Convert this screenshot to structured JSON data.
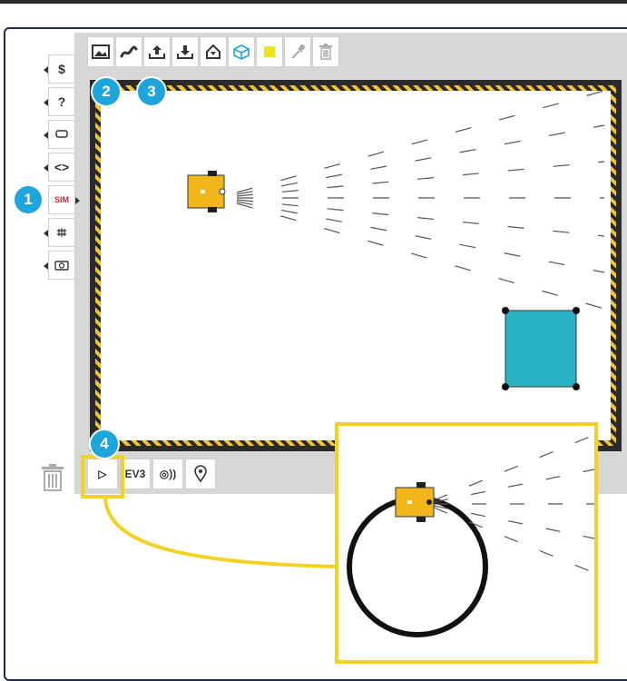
{
  "toolbar": {
    "tools": [
      {
        "icon": "image-icon",
        "name": "background-image-tool"
      },
      {
        "icon": "line-pen-icon",
        "name": "draw-line-tool"
      },
      {
        "icon": "upload-icon",
        "name": "import-tool"
      },
      {
        "icon": "download-icon",
        "name": "export-tool"
      },
      {
        "icon": "download-alt-icon",
        "name": "export-alt-tool"
      },
      {
        "icon": "cube-icon",
        "name": "add-obstacle-tool"
      },
      {
        "icon": "yellow-square-icon",
        "name": "color-area-tool"
      },
      {
        "icon": "eyedropper-icon",
        "name": "color-picker-tool"
      },
      {
        "icon": "trash-icon",
        "name": "delete-tool"
      }
    ]
  },
  "sidebar": {
    "items": [
      {
        "label": "$",
        "icon": "dollar-icon"
      },
      {
        "label": "?",
        "icon": "help-icon"
      },
      {
        "label": "",
        "icon": "comment-icon"
      },
      {
        "label": "<>",
        "icon": "code-icon"
      },
      {
        "label": "SIM",
        "icon": "sim-icon"
      },
      {
        "label": "",
        "icon": "bug-icon"
      },
      {
        "label": "",
        "icon": "camera-icon"
      }
    ]
  },
  "bottom": {
    "play_label": "▷",
    "ev3_label": "EV3",
    "sound_label": "◎))",
    "pin_label": "⚲"
  },
  "badges": {
    "b1": "1",
    "b2": "2",
    "b3": "3",
    "b4": "4"
  },
  "colors": {
    "accent": "#1ea5d9",
    "highlight": "#f3d123",
    "obstacle": "#2ab3c4",
    "robot": "#f2b51a"
  }
}
